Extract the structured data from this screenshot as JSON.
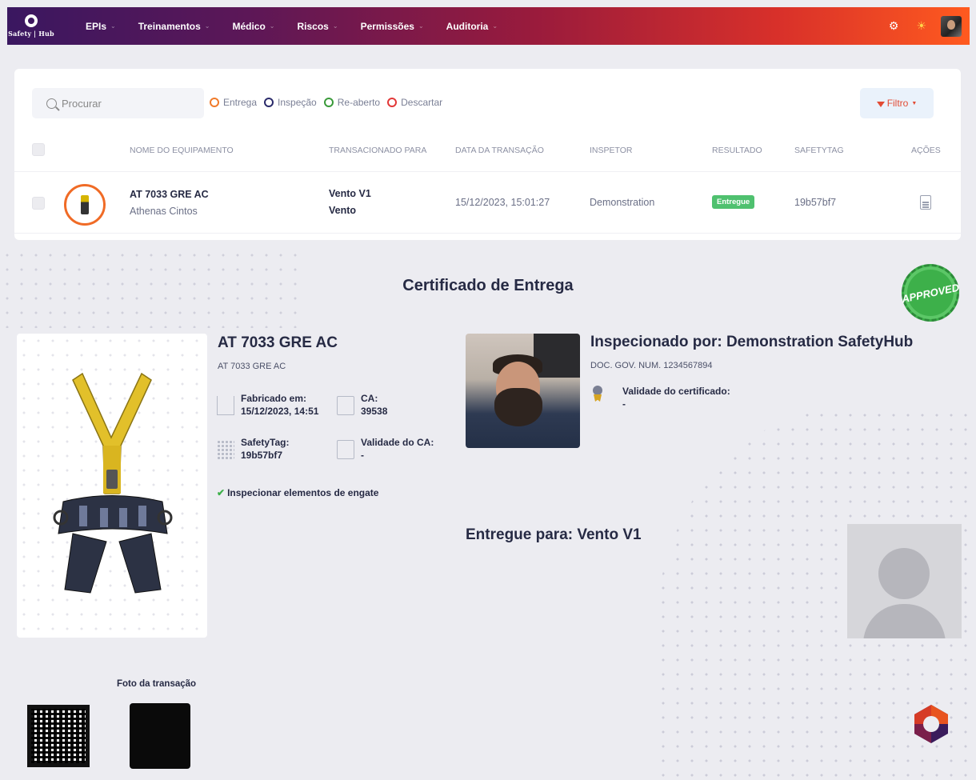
{
  "header": {
    "logo_text": "Safety | Hub",
    "nav": [
      {
        "label": "EPIs"
      },
      {
        "label": "Treinamentos"
      },
      {
        "label": "Médico"
      },
      {
        "label": "Riscos"
      },
      {
        "label": "Permissões"
      },
      {
        "label": "Auditoria"
      }
    ],
    "icons": [
      "settings-icon",
      "sun-icon",
      "user-avatar"
    ]
  },
  "search": {
    "placeholder": "Procurar"
  },
  "legend": [
    {
      "label": "Entrega",
      "color": "#f07a2a"
    },
    {
      "label": "Inspeção",
      "color": "#2b2b6b"
    },
    {
      "label": "Re-aberto",
      "color": "#3a9a3a"
    },
    {
      "label": "Descartar",
      "color": "#e23838"
    }
  ],
  "filter": {
    "label": "Filtro"
  },
  "table": {
    "columns": [
      "Nome do equipamento",
      "Transacionado para",
      "Data da transação",
      "Inspetor",
      "Resultado",
      "Safetytag",
      "Ações"
    ],
    "rows": [
      {
        "name": "AT 7033 GRE AC",
        "brand": "Athenas Cintos",
        "to_line1": "Vento V1",
        "to_line2": "Vento",
        "date": "15/12/2023, 15:01:27",
        "inspector": "Demonstration",
        "result": "Entregue",
        "safetytag": "19b57bf7"
      }
    ]
  },
  "certificate": {
    "title": "Certificado de Entrega",
    "stamp": "APPROVED",
    "equipment_name": "AT 7033 GRE AC",
    "equipment_sub": "AT 7033 GRE AC",
    "fabricado_label": "Fabricado em:",
    "fabricado_value": "15/12/2023, 14:51",
    "ca_label": "CA:",
    "ca_value": "39538",
    "safetytag_label": "SafetyTag:",
    "safetytag_value": "19b57bf7",
    "validade_ca_label": "Validade do CA:",
    "validade_ca_value": "-",
    "check_item": "Inspecionar elementos de engate",
    "inspector_title": "Inspecionado por: Demonstration SafetyHub",
    "inspector_doc": "DOC. GOV. NUM. 1234567894",
    "cert_validity_label": "Validade do certificado:",
    "cert_validity_value": "-",
    "delivered_to": "Entregue para: Vento V1",
    "photo_label": "Foto da transação"
  }
}
